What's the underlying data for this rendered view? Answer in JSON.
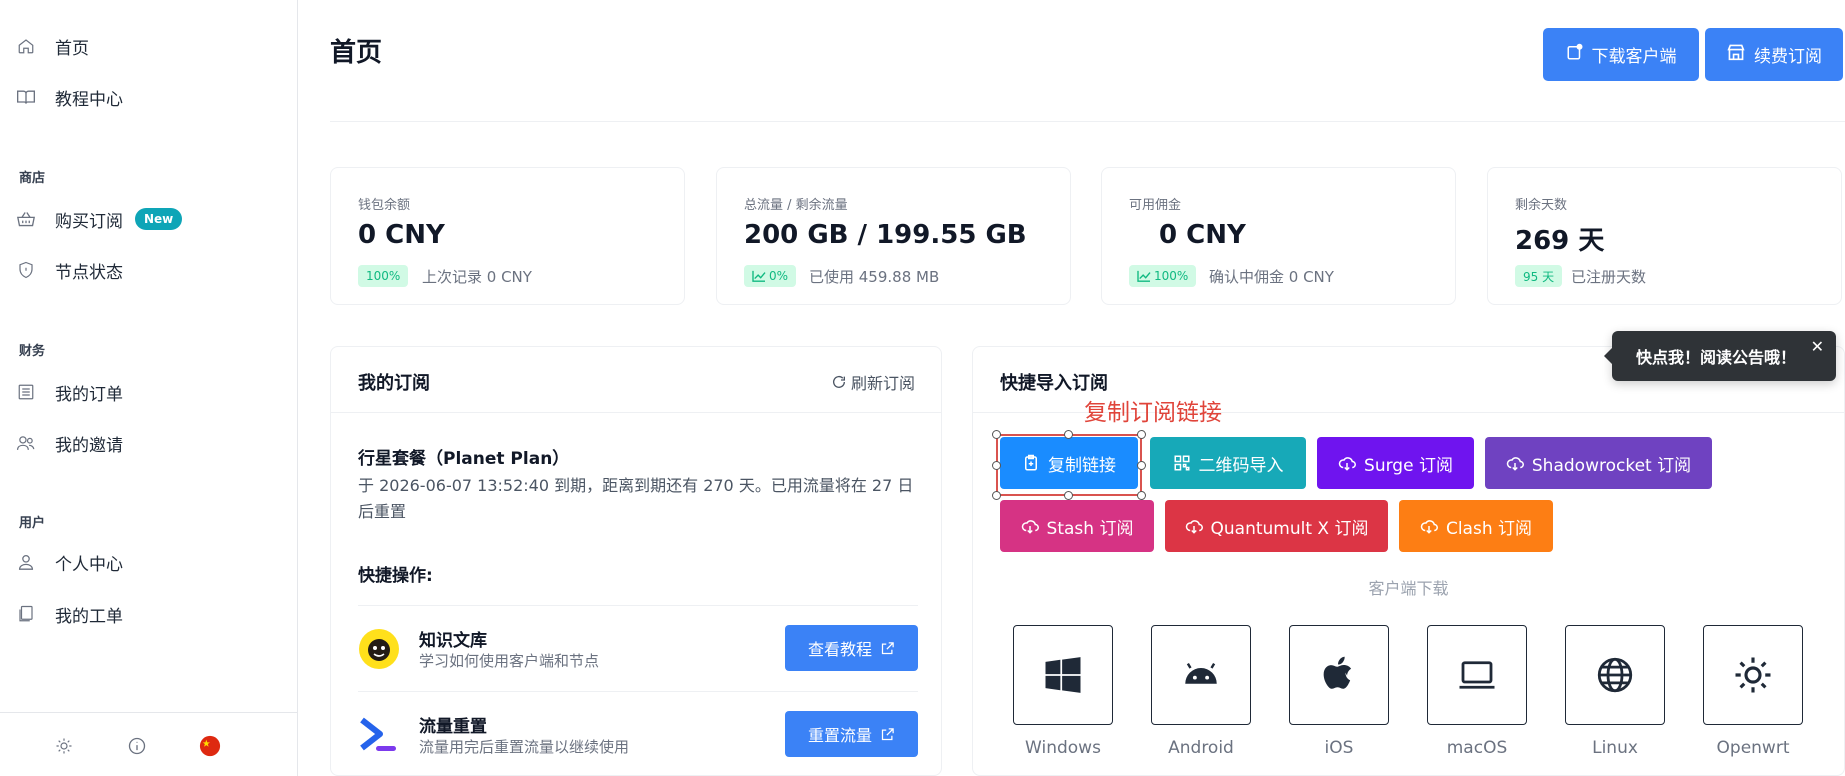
{
  "sidebar": {
    "items": [
      {
        "label": "首页",
        "icon": "home-icon"
      },
      {
        "label": "教程中心",
        "icon": "book-icon"
      },
      {
        "label": "购买订阅",
        "icon": "basket-icon",
        "badge": "New"
      },
      {
        "label": "节点状态",
        "icon": "shield-icon"
      },
      {
        "label": "我的订单",
        "icon": "order-list-icon"
      },
      {
        "label": "我的邀请",
        "icon": "users-icon"
      },
      {
        "label": "个人中心",
        "icon": "user-icon"
      },
      {
        "label": "我的工单",
        "icon": "ticket-icon"
      }
    ],
    "sections": [
      "商店",
      "财务",
      "用户"
    ]
  },
  "header": {
    "title": "首页",
    "download_client": "下载客户端",
    "renew": "续费订阅"
  },
  "stats": [
    {
      "label": "钱包余额",
      "value": "0 CNY",
      "chip": "100%",
      "note": "上次记录 0 CNY"
    },
    {
      "label": "总流量 / 剩余流量",
      "value": "200 GB / 199.55 GB",
      "chip": "0%",
      "note": "已使用 459.88 MB"
    },
    {
      "label": "可用佣金",
      "value": "0 CNY",
      "chip": "100%",
      "note": "确认中佣金 0 CNY"
    },
    {
      "label": "剩余天数",
      "value": "269 天",
      "chip": "95 天",
      "note": "已注册天数"
    }
  ],
  "subscription": {
    "title": "我的订阅",
    "refresh": "刷新订阅",
    "plan_name": "行星套餐（Planet Plan）",
    "plan_desc": "于 2026-06-07 13:52:40 到期，距离到期还有 270 天。已用流量将在 27 日后重置",
    "quick_title": "快捷操作:",
    "actions": [
      {
        "title": "知识文库",
        "desc": "学习如何使用客户端和节点",
        "button": "查看教程"
      },
      {
        "title": "流量重置",
        "desc": "流量用完后重置流量以继续使用",
        "button": "重置流量"
      }
    ]
  },
  "import": {
    "title": "快捷导入订阅",
    "annotation": "复制订阅链接",
    "buttons": [
      {
        "label": "复制链接",
        "color": "#1a8cff"
      },
      {
        "label": "二维码导入",
        "color": "#17a9b8"
      },
      {
        "label": "Surge 订阅",
        "color": "#6f14ef"
      },
      {
        "label": "Shadowrocket 订阅",
        "color": "#6f42c1"
      },
      {
        "label": "Stash 订阅",
        "color": "#d63384"
      },
      {
        "label": "Quantumult X 订阅",
        "color": "#dc3545"
      },
      {
        "label": "Clash 订阅",
        "color": "#fd7e14"
      }
    ],
    "client_title": "客户端下载",
    "clients": [
      "Windows",
      "Android",
      "iOS",
      "macOS",
      "Linux",
      "Openwrt"
    ]
  },
  "toast": {
    "text": "快点我！阅读公告哦！",
    "close": "✕"
  },
  "colors": {
    "primary": "#3b82f6",
    "chip_bg": "#d1fae5",
    "chip_fg": "#10b981"
  }
}
